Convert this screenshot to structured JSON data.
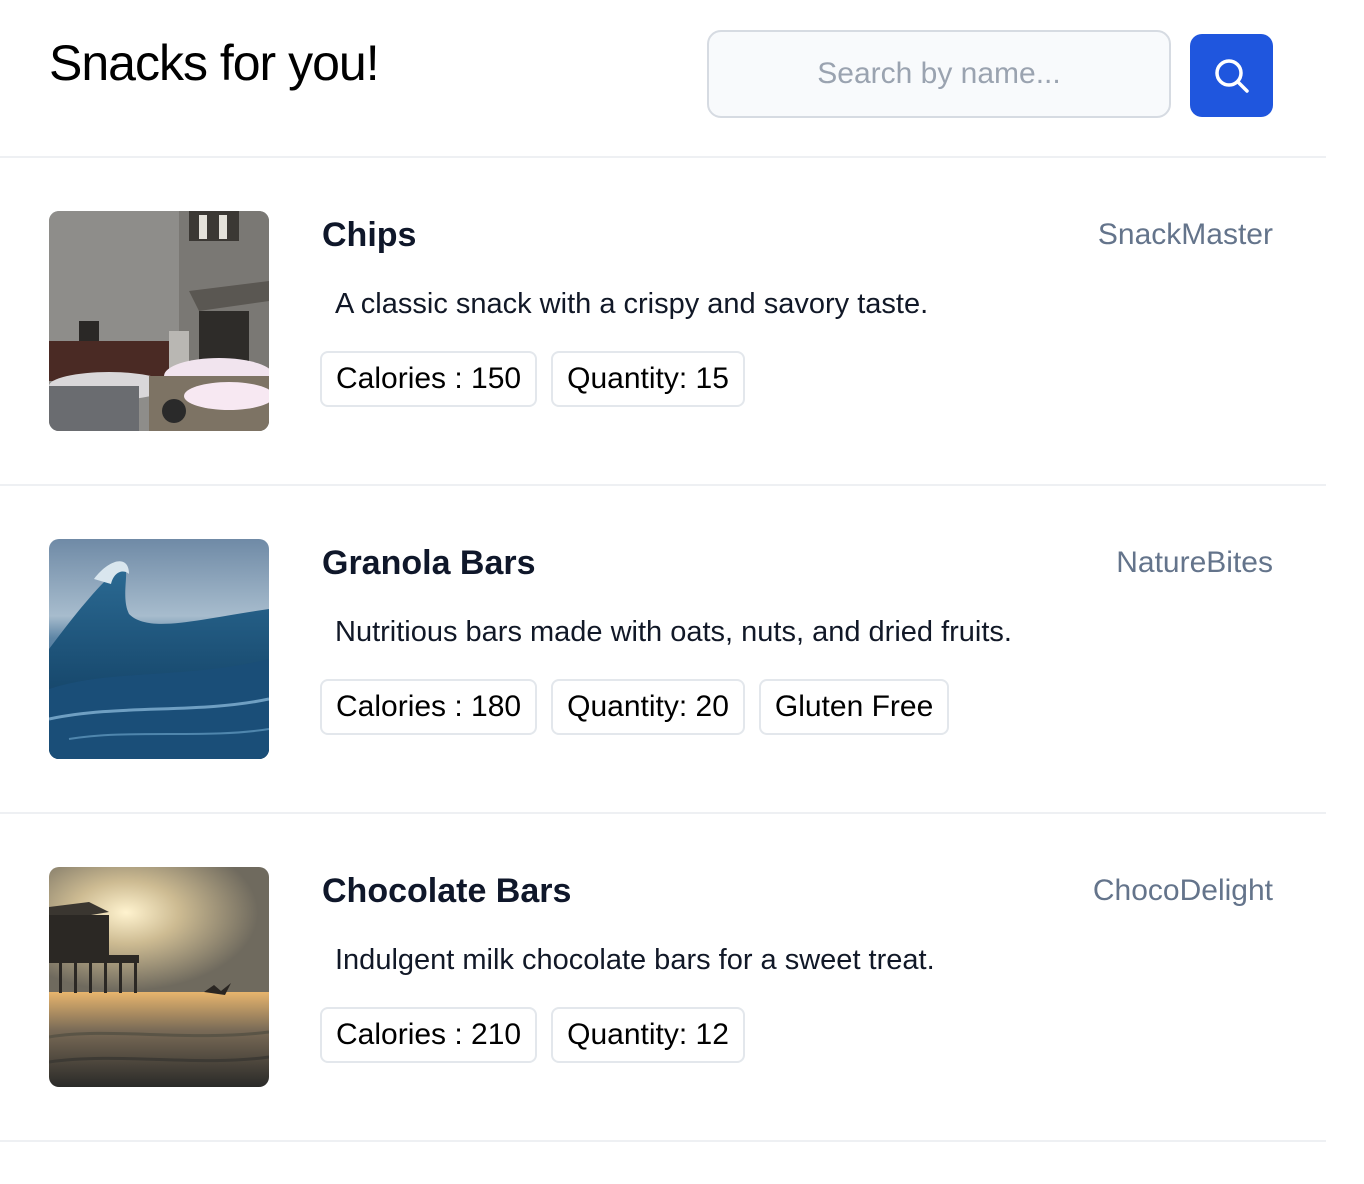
{
  "header": {
    "title": "Snacks for you!",
    "search_placeholder": "Search by name...",
    "search_icon": "search-icon"
  },
  "colors": {
    "accent": "#1f56de",
    "brand_text": "#64748b",
    "border": "#e3e7ec"
  },
  "snacks": [
    {
      "name": "Chips",
      "brand": "SnackMaster",
      "description": "A classic snack with a crispy and savory taste.",
      "calories": "Calories : 150",
      "quantity": "Quantity: 15",
      "image": "snowy-street-photo"
    },
    {
      "name": "Granola Bars",
      "brand": "NatureBites",
      "description": "Nutritious bars made with oats, nuts, and dried fruits.",
      "calories": "Calories : 180",
      "quantity": "Quantity: 20",
      "extra_tag": "Gluten Free",
      "image": "ocean-wave-photo"
    },
    {
      "name": "Chocolate Bars",
      "brand": "ChocoDelight",
      "description": "Indulgent milk chocolate bars for a sweet treat.",
      "calories": "Calories : 210",
      "quantity": "Quantity: 12",
      "image": "pier-sunset-photo"
    }
  ]
}
